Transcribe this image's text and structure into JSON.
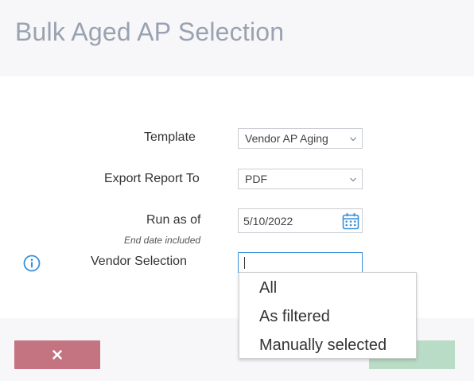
{
  "dialog": {
    "title": "Bulk Aged AP Selection"
  },
  "form": {
    "template_label": "Template",
    "template_value": "Vendor AP Aging",
    "export_label": "Export Report To",
    "export_value": "PDF",
    "run_as_of_label": "Run as of",
    "run_as_of_sublabel": "End date included",
    "run_as_of_value": "5/10/2022",
    "vendor_selection_label": "Vendor Selection",
    "vendor_selection_value": ""
  },
  "vendor_dropdown": {
    "options": [
      "All",
      "As filtered",
      "Manually selected"
    ]
  },
  "icons": {
    "info": "info-icon",
    "calendar": "calendar-icon",
    "chevron": "chevron-down-icon",
    "close": "close-icon"
  },
  "colors": {
    "title": "#9aa2b1",
    "accent_blue": "#3a8fd6",
    "cancel_button": "#c47481",
    "ok_button": "#b9dcc6"
  }
}
